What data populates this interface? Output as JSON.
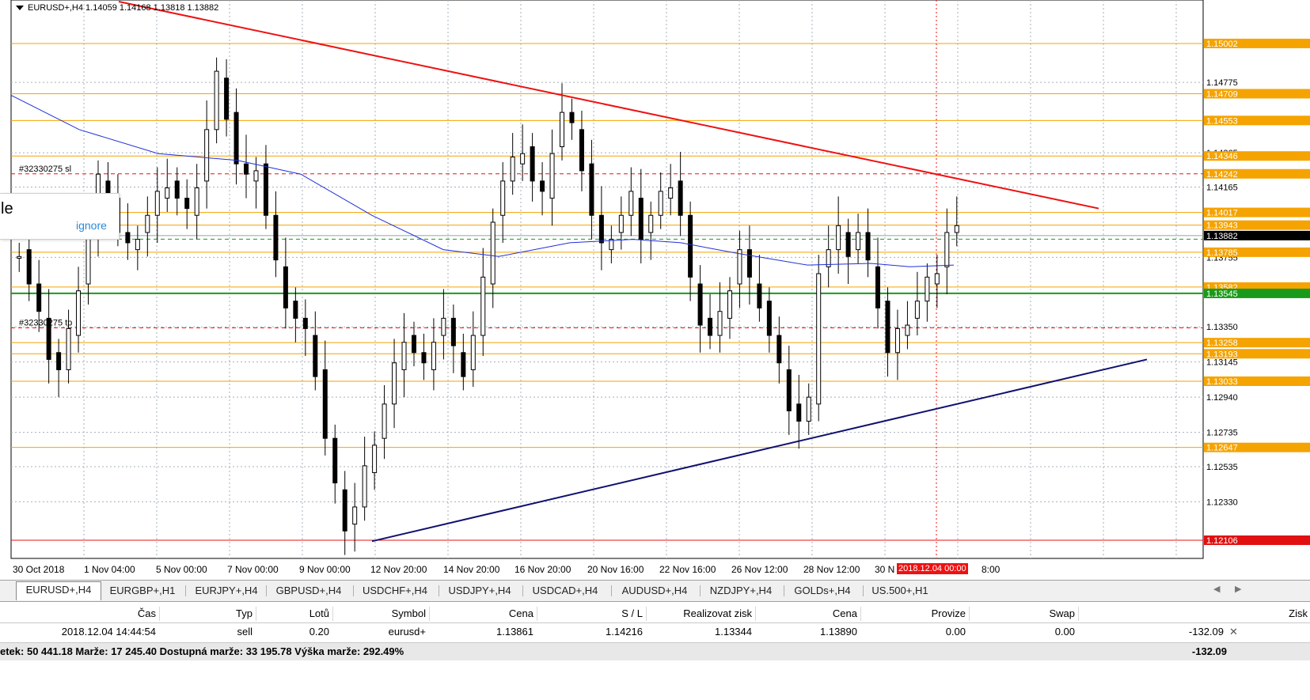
{
  "chart": {
    "symbol_header": "EURUSD+,H4  1.14059 1.14168 1.13818 1.13882",
    "price_min": 1.12,
    "price_max": 1.152,
    "price_labels": [
      {
        "text": "1.15002",
        "price": 1.15002,
        "color": "#f5a300"
      },
      {
        "text": "1.14775",
        "price": 1.14775,
        "color": null
      },
      {
        "text": "1.14709",
        "price": 1.14709,
        "color": "#f5a300"
      },
      {
        "text": "1.14553",
        "price": 1.14553,
        "color": "#f5a300"
      },
      {
        "text": "1.14365",
        "price": 1.14365,
        "color": null
      },
      {
        "text": "1.14346",
        "price": 1.14346,
        "color": "#f5a300"
      },
      {
        "text": "1.14242",
        "price": 1.14242,
        "color": "#f5a300"
      },
      {
        "text": "1.14165",
        "price": 1.14165,
        "color": null
      },
      {
        "text": "1.14017",
        "price": 1.14017,
        "color": "#f5a300"
      },
      {
        "text": "1.13943",
        "price": 1.13943,
        "color": "#f5a300"
      },
      {
        "text": "1.13882",
        "price": 1.13882,
        "color": "#000000"
      },
      {
        "text": "1.13755",
        "price": 1.13755,
        "color": null
      },
      {
        "text": "1.13785",
        "price": 1.13785,
        "color": "#f5a300"
      },
      {
        "text": "1.13582",
        "price": 1.13582,
        "color": "#f5a300"
      },
      {
        "text": "1.13545",
        "price": 1.13545,
        "color": "#1a9a1a"
      },
      {
        "text": "1.13350",
        "price": 1.1335,
        "color": null
      },
      {
        "text": "1.13258",
        "price": 1.13258,
        "color": "#f5a300"
      },
      {
        "text": "1.13193",
        "price": 1.13193,
        "color": "#f5a300"
      },
      {
        "text": "1.13145",
        "price": 1.13145,
        "color": null
      },
      {
        "text": "1.13033",
        "price": 1.13033,
        "color": "#f5a300"
      },
      {
        "text": "1.12940",
        "price": 1.1294,
        "color": null
      },
      {
        "text": "1.12735",
        "price": 1.12735,
        "color": null
      },
      {
        "text": "1.12647",
        "price": 1.12647,
        "color": "#f5a300"
      },
      {
        "text": "1.12535",
        "price": 1.12535,
        "color": null
      },
      {
        "text": "1.12330",
        "price": 1.1233,
        "color": null
      },
      {
        "text": "1.12106",
        "price": 1.12106,
        "color": "#e11111"
      }
    ],
    "horizontal_levels": [
      1.15002,
      1.14709,
      1.14553,
      1.14346,
      1.14017,
      1.13943,
      1.13785,
      1.13582,
      1.13258,
      1.13193,
      1.13033,
      1.12647
    ],
    "sl_label": "#32330275 sl",
    "sl_price": 1.14242,
    "tp_label": "#32330275 tp",
    "tp_price": 1.13344,
    "bid_price": 1.13882,
    "entry_price": 1.13861,
    "green_level": 1.13545,
    "red_level": 1.12106,
    "date_labels": [
      "30 Oct 2018",
      "1 Nov 04:00",
      "5 Nov 00:00",
      "7 Nov 00:00",
      "9 Nov 00:00",
      "12 Nov 20:00",
      "14 Nov 20:00",
      "16 Nov 20:00",
      "20 Nov 16:00",
      "22 Nov 16:00",
      "26 Nov 12:00",
      "28 Nov 12:00",
      "30 N",
      "8:00"
    ],
    "cursor_date_label": "2018.12.04 00:00",
    "popup_text": "le",
    "popup_link": "ignore"
  },
  "tabs": [
    "EURUSD+,H4",
    "EURGBP+,H1",
    "EURJPY+,H4",
    "GBPUSD+,H4",
    "USDCHF+,H4",
    "USDJPY+,H4",
    "USDCAD+,H4",
    "AUDUSD+,H4",
    "NZDJPY+,H4",
    "GOLDs+,H4",
    "US.500+,H1"
  ],
  "active_tab": 0,
  "terminal": {
    "headers": [
      "Čas",
      "Typ",
      "Lotů",
      "Symbol",
      "Cena",
      "S / L",
      "Realizovat zisk",
      "Cena",
      "Provize",
      "Swap",
      "Zisk"
    ],
    "row": [
      "2018.12.04 14:44:54",
      "sell",
      "0.20",
      "eurusd+",
      "1.13861",
      "1.14216",
      "1.13344",
      "1.13890",
      "0.00",
      "0.00",
      "-132.09"
    ],
    "close_icon": "close-icon",
    "summary": "etek: 50 441.18  Marže: 17 245.40  Dostupná marže: 33 195.78  Výška marže: 292.49%",
    "summary_total": "-132.09"
  }
}
